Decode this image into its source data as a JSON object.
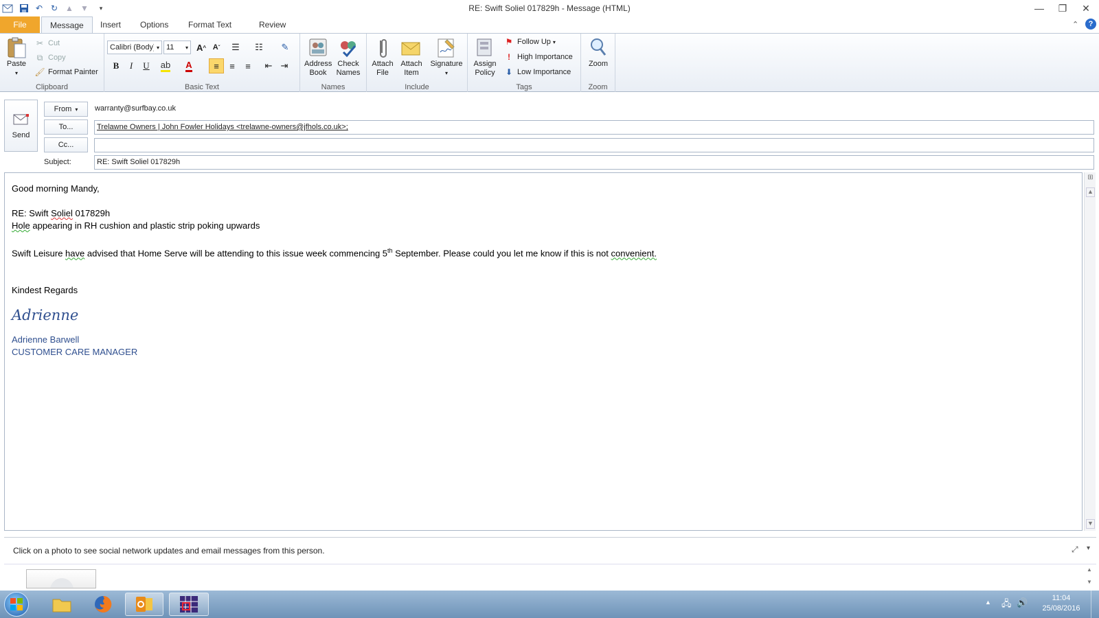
{
  "window": {
    "title": "RE: Swift Soliel  017829h  -  Message (HTML)"
  },
  "tabs": [
    {
      "label": "File"
    },
    {
      "label": "Message"
    },
    {
      "label": "Insert"
    },
    {
      "label": "Options"
    },
    {
      "label": "Format Text"
    },
    {
      "label": "Review"
    }
  ],
  "clipboard": {
    "group": "Clipboard",
    "paste": "Paste",
    "cut": "Cut",
    "copy": "Copy",
    "format_painter": "Format Painter"
  },
  "basic_text": {
    "group": "Basic Text",
    "font": "Calibri (Body)",
    "size": "11",
    "bold": "B",
    "italic": "I",
    "underline": "U"
  },
  "names": {
    "group": "Names",
    "address_book": "Address Book",
    "check_names": "Check Names"
  },
  "include": {
    "group": "Include",
    "attach_file": "Attach File",
    "attach_item": "Attach Item",
    "signature": "Signature"
  },
  "tags": {
    "group": "Tags",
    "assign_policy": "Assign Policy",
    "follow_up": "Follow Up",
    "high": "High Importance",
    "low": "Low Importance"
  },
  "zoom": {
    "group": "Zoom",
    "zoom": "Zoom"
  },
  "header": {
    "send": "Send",
    "from_label": "From",
    "from_value": "warranty@surfbay.co.uk",
    "to_label": "To...",
    "to_value": "Trelawne Owners  |  John Fowler Holidays <trelawne-owners@jfhols.co.uk>;",
    "cc_label": "Cc...",
    "cc_value": "",
    "subject_label": "Subject:",
    "subject_value": "RE: Swift Soliel  017829h"
  },
  "message": {
    "greeting": "Good morning Mandy,",
    "re_prefix": "RE: Swift ",
    "re_soliel": "Soliel",
    "re_suffix": "  017829h",
    "hole_word": "Hole",
    "hole_rest": " appearing in RH cushion and plastic strip poking upwards",
    "p1_a": "Swift Leisure ",
    "p1_have": "have",
    "p1_b": " advised that Home Serve will be attending to this issue week commencing 5",
    "p1_sup": "th",
    "p1_c": " September.  Please could you let me know if this is not ",
    "p1_conv": "convenient.",
    "regards": "Kindest Regards",
    "sig_script": "Adrienne",
    "sig_name": "Adrienne Barwell",
    "sig_title": "CUSTOMER CARE MANAGER"
  },
  "people_pane": {
    "text": "Click on a photo to see social network updates and email messages from this person."
  },
  "taskbar": {
    "time": "11:04",
    "date": "25/08/2016"
  }
}
